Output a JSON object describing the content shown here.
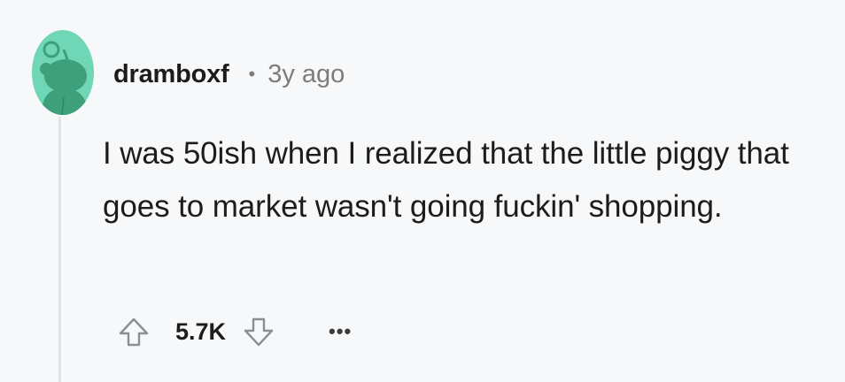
{
  "comment": {
    "username": "dramboxf",
    "separator": "•",
    "age": "3y ago",
    "body": "I was 50ish when I realized that the little piggy that goes to market wasn't going fuckin' shopping.",
    "score": "5.7K",
    "more_label": "•••"
  },
  "icons": {
    "avatar": "snoo-avatar-icon",
    "upvote": "upvote-arrow-icon",
    "downvote": "downvote-arrow-icon",
    "more": "more-options-icon"
  },
  "colors": {
    "avatar_bg": "#6fd7b5",
    "avatar_figure": "#3e9f7b",
    "text": "#1c1c1c",
    "muted": "#7c7c7c",
    "thread_line": "#dfe3e8"
  }
}
